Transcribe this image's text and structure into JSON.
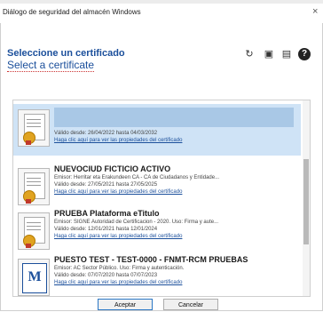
{
  "window": {
    "title": "Diálogo de seguridad del almacén Windows",
    "close_glyph": "×"
  },
  "header": {
    "title_es": "Seleccione un certificado",
    "title_en": "Select a certificate"
  },
  "toolbar": {
    "icons": [
      "refresh-icon",
      "view-certificate-icon",
      "smartcard-icon",
      "help-icon"
    ],
    "help_glyph": "?"
  },
  "certificates": [
    {
      "name": "",
      "issuer": "",
      "validity": "Válido desde: 26/04/2022 hasta 04/03/2032",
      "link": "Haga clic aquí para ver las propiedades del certificado",
      "selected": true,
      "icon": "certificate-icon"
    },
    {
      "name": "NUEVOCIUD FICTICIO ACTIVO",
      "issuer": "Emisor: Herritar eta Erakundeen CA - CA de Ciudadanos y Entidade...",
      "validity": "Válido desde: 27/05/2021 hasta 27/05/2025",
      "link": "Haga clic aquí para ver las propiedades del certificado",
      "selected": false,
      "icon": "certificate-icon"
    },
    {
      "name": "PRUEBA Plataforma eTitulo",
      "issuer": "Emisor: SIGNE Autoridad de Certificacion - 2020. Uso: Firma y aute...",
      "validity": "Válido desde: 12/01/2021 hasta 12/01/2024",
      "link": "Haga clic aquí para ver las propiedades del certificado",
      "selected": false,
      "icon": "certificate-icon"
    },
    {
      "name": "PUESTO TEST - TEST-0000 - FNMT-RCM PRUEBAS",
      "issuer": "Emisor: AC Sector Público. Uso: Firma y autenticación.",
      "validity": "Válido desde: 07/07/2020 hasta 07/07/2023",
      "link": "Haga clic aquí para ver las propiedades del certificado",
      "selected": false,
      "icon": "fnmt-logo-icon",
      "icon_glyph": "M"
    }
  ],
  "buttons": {
    "accept": "Aceptar",
    "cancel": "Cancelar"
  }
}
